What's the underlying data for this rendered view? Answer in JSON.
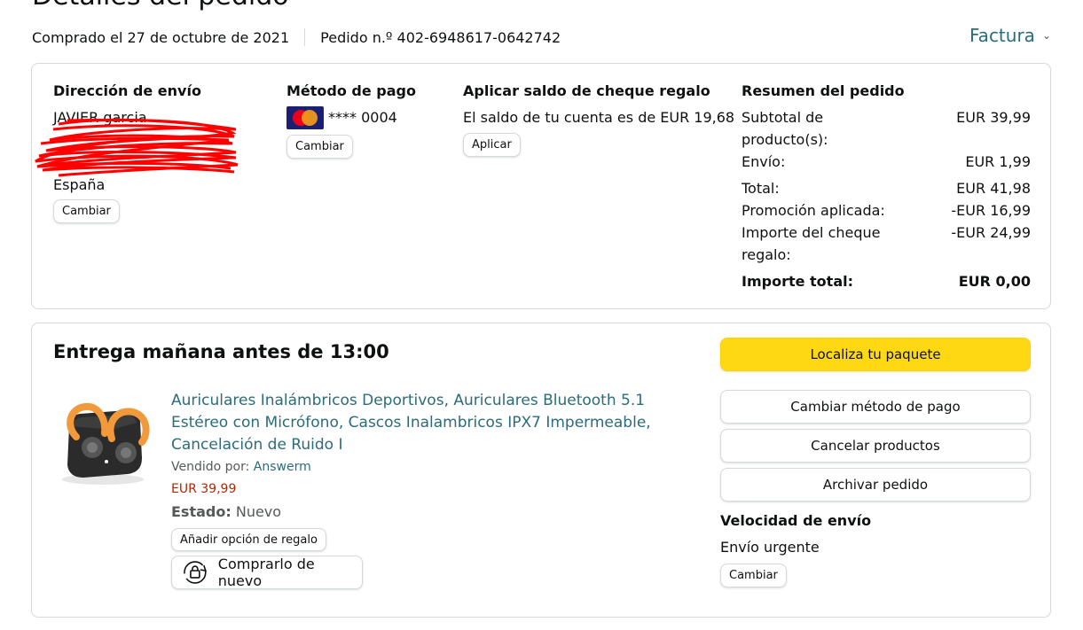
{
  "header": {
    "title": "Detalles del pedido",
    "purchase_date": "Comprado el 27 de octubre de 2021",
    "order_number": "Pedido n.º 402-6948617-0642742",
    "invoice_label": "Factura"
  },
  "address": {
    "title": "Dirección de envío",
    "name": "JAVIER garcia",
    "country": "España",
    "change_label": "Cambiar"
  },
  "payment": {
    "title": "Método de pago",
    "card_mask": "**** 0004",
    "card_icon": "mastercard-icon",
    "change_label": "Cambiar"
  },
  "gift": {
    "title": "Aplicar saldo de cheque regalo",
    "balance_text": "El saldo de tu cuenta es de EUR 19,68",
    "apply_label": "Aplicar"
  },
  "summary": {
    "title": "Resumen del pedido",
    "rows": [
      {
        "label": "Subtotal de producto(s):",
        "value": "EUR 39,99"
      },
      {
        "label": "Envío:",
        "value": "EUR 1,99"
      },
      {
        "label": "Total:",
        "value": "EUR 41,98"
      },
      {
        "label": "Promoción aplicada:",
        "value": "-EUR 16,99"
      },
      {
        "label": "Importe del cheque regalo:",
        "value": "-EUR 24,99"
      },
      {
        "label": "Importe total:",
        "value": "EUR 0,00"
      }
    ]
  },
  "delivery": {
    "title": "Entrega mañana antes de 13:00",
    "product": {
      "title": "Auriculares Inalámbricos Deportivos, Auriculares Bluetooth 5.1 Estéreo con Micrófono, Cascos Inalambricos IPX7 Impermeable, Cancelación de Ruido I",
      "seller_label": "Vendido por:",
      "seller_name": "Answerm",
      "price": "EUR 39,99",
      "status_label": "Estado:",
      "status_value": "Nuevo",
      "gift_option_label": "Añadir opción de regalo",
      "buy_again_label": "Comprarlo de nuevo"
    },
    "actions": {
      "track": "Localiza tu paquete",
      "change_payment": "Cambiar método de pago",
      "cancel": "Cancelar productos",
      "archive": "Archivar pedido"
    },
    "shipping_speed": {
      "title": "Velocidad de envío",
      "value": "Envío urgente",
      "change_label": "Cambiar"
    }
  },
  "colors": {
    "primary_button": "#ffd814",
    "link": "#2a6c7a",
    "price": "#b12704",
    "redaction": "#ff0000"
  }
}
